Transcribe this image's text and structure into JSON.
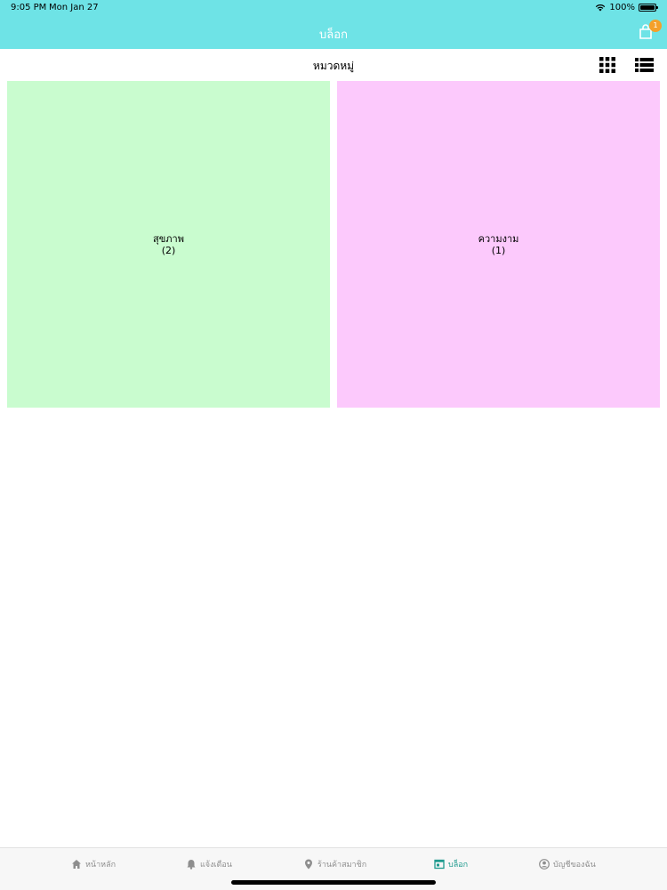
{
  "status_bar": {
    "time": "9:05 PM",
    "date": "Mon Jan 27",
    "battery": "100%",
    "battery_level": 1.0
  },
  "header": {
    "title": "บล็อก",
    "cart_badge": "1",
    "background_color": "#6ee3e6",
    "badge_color": "#f4a02a"
  },
  "toolbar": {
    "title": "หมวดหมู่",
    "grid_icon": "grid-view-icon",
    "list_icon": "list-view-icon"
  },
  "categories": [
    {
      "name": "สุขภาพ",
      "count": "(2)",
      "color": "#c9fccf"
    },
    {
      "name": "ความงาม",
      "count": "(1)",
      "color": "#fcc9fc"
    }
  ],
  "tabbar": {
    "active_color": "#1e9a8e",
    "items": [
      {
        "label": "หน้าหลัก",
        "icon": "home-icon"
      },
      {
        "label": "แจ้งเตือน",
        "icon": "bell-icon"
      },
      {
        "label": "ร้านค้าสมาชิก",
        "icon": "location-pin-icon"
      },
      {
        "label": "บล็อก",
        "icon": "blog-icon",
        "active": true
      },
      {
        "label": "บัญชีของฉัน",
        "icon": "account-icon"
      }
    ]
  }
}
